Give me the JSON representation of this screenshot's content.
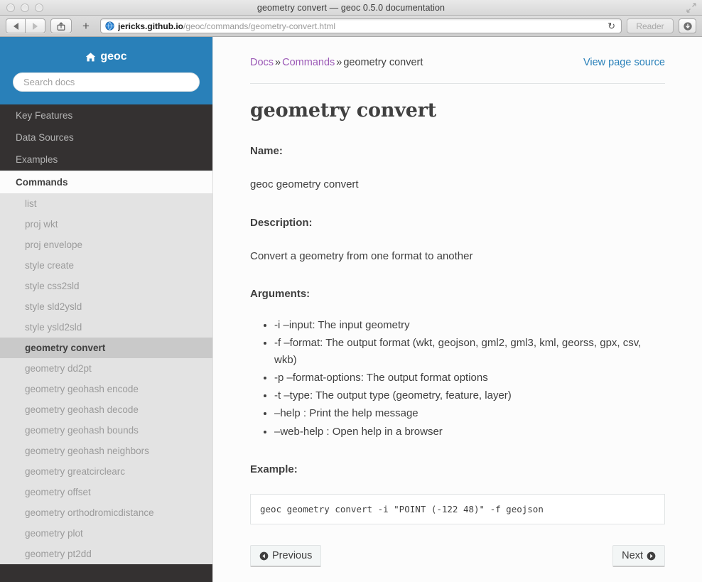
{
  "browser": {
    "window_title": "geometry convert — geoc 0.5.0 documentation",
    "back_icon": "back-arrow-icon",
    "forward_icon": "forward-arrow-icon",
    "share_icon": "share-icon",
    "add_tab_label": "+",
    "url_host": "jericks.github.io",
    "url_path": "/geoc/commands/geometry-convert.html",
    "reload_glyph": "↻",
    "reader_label": "Reader",
    "downloads_icon": "downloads-icon",
    "fullscreen_icon": "fullscreen-icon"
  },
  "sidebar": {
    "brand": "geoc",
    "brand_icon": "home-icon",
    "search_placeholder": "Search docs",
    "search_value": "",
    "top_items": [
      {
        "label": "Key Features"
      },
      {
        "label": "Data Sources"
      },
      {
        "label": "Examples"
      }
    ],
    "section_header": "Commands",
    "sub_items": [
      {
        "label": "list",
        "current": false
      },
      {
        "label": "proj wkt",
        "current": false
      },
      {
        "label": "proj envelope",
        "current": false
      },
      {
        "label": "style create",
        "current": false
      },
      {
        "label": "style css2sld",
        "current": false
      },
      {
        "label": "style sld2ysld",
        "current": false
      },
      {
        "label": "style ysld2sld",
        "current": false
      },
      {
        "label": "geometry convert",
        "current": true
      },
      {
        "label": "geometry dd2pt",
        "current": false
      },
      {
        "label": "geometry geohash encode",
        "current": false
      },
      {
        "label": "geometry geohash decode",
        "current": false
      },
      {
        "label": "geometry geohash bounds",
        "current": false
      },
      {
        "label": "geometry geohash neighbors",
        "current": false
      },
      {
        "label": "geometry greatcirclearc",
        "current": false
      },
      {
        "label": "geometry offset",
        "current": false
      },
      {
        "label": "geometry orthodromicdistance",
        "current": false
      },
      {
        "label": "geometry plot",
        "current": false
      },
      {
        "label": "geometry pt2dd",
        "current": false
      }
    ]
  },
  "content": {
    "breadcrumb": {
      "docs": "Docs",
      "sep1": "»",
      "commands": "Commands",
      "sep2": "»",
      "current": "geometry convert"
    },
    "view_page_source": "View page source",
    "title": "geometry convert",
    "name_label": "Name:",
    "name_value": "geoc geometry convert",
    "description_label": "Description:",
    "description_value": "Convert a geometry from one format to another",
    "arguments_label": "Arguments:",
    "arguments": [
      "-i –input: The input geometry",
      "-f –format: The output format (wkt, geojson, gml2, gml3, kml, georss, gpx, csv, wkb)",
      "-p –format-options: The output format options",
      "-t –type: The output type (geometry, feature, layer)",
      "–help : Print the help message",
      "–web-help : Open help in a browser"
    ],
    "example_label": "Example:",
    "example_code": "geoc geometry convert -i \"POINT (-122 48)\" -f geojson",
    "prev_label": "Previous",
    "next_label": "Next",
    "prev_icon": "circle-left-arrow-icon",
    "next_icon": "circle-right-arrow-icon"
  },
  "colors": {
    "sidebar_search_bg": "#2980B9",
    "sidebar_bg": "#343131",
    "sidebar_sub_bg": "#e3e3e3",
    "sidebar_current_bg": "#c9c9c9",
    "link_blue": "#2980B9",
    "link_visited_purple": "#9B59B6",
    "text": "#404040",
    "page_bg": "#fcfcfc"
  }
}
